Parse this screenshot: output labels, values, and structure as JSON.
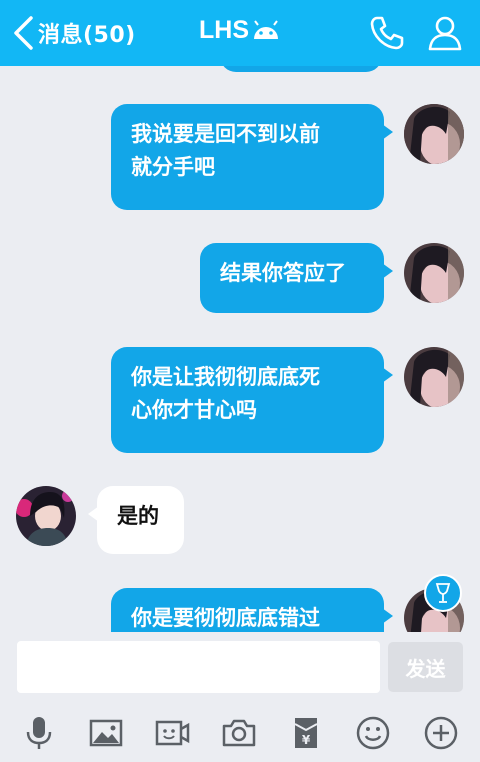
{
  "header": {
    "back_label": "消息(50)",
    "title": "LHS"
  },
  "messages": [
    {
      "side": "out",
      "text": ""
    },
    {
      "side": "out",
      "line1": "我说要是回不到以前",
      "line2": "就分手吧"
    },
    {
      "side": "out",
      "line1": "结果你答应了"
    },
    {
      "side": "out",
      "line1": "你是让我彻彻底底死",
      "line2": "心你才甘心吗"
    },
    {
      "side": "in",
      "line1": "是的"
    },
    {
      "side": "out",
      "line1": "你是要彻彻底底错过"
    }
  ],
  "input": {
    "value": "",
    "send_label": "发送"
  },
  "toolbar": {
    "icons": [
      "microphone-icon",
      "image-icon",
      "video-call-icon",
      "camera-icon",
      "red-packet-icon",
      "emoji-icon",
      "plus-icon"
    ]
  },
  "colors": {
    "header": "#12b7f5",
    "bubble_out": "#12a6e8",
    "bubble_in": "#ffffff",
    "background": "#ebedf2"
  }
}
